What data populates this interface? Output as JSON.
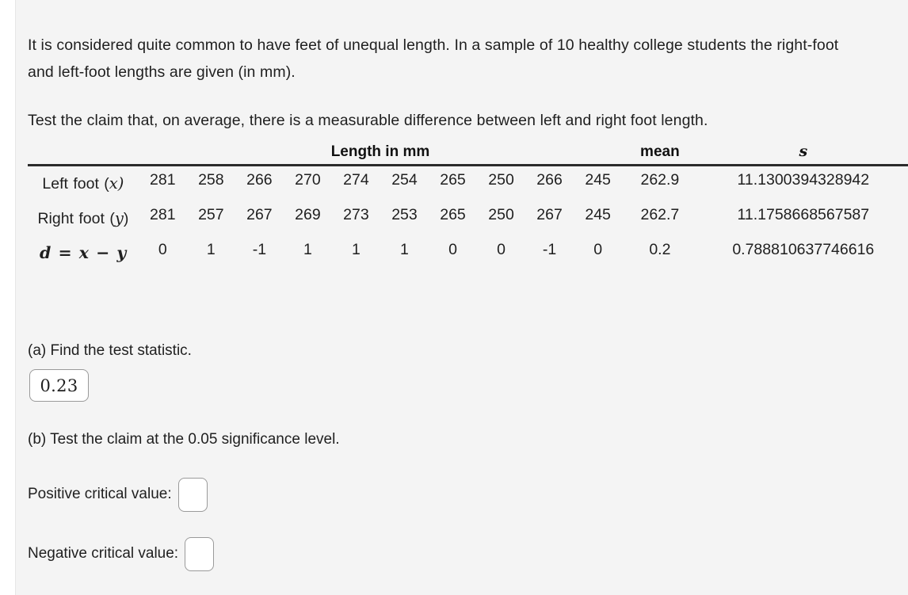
{
  "intro": {
    "paragraph": "It is considered quite common to have feet of unequal length. In a sample of 10 healthy college students the right-foot and left-foot lengths are given (in mm).",
    "claim": "Test the claim that, on average, there is a measurable difference between left and right foot length."
  },
  "table": {
    "headers": {
      "label": "",
      "length": "Length in mm",
      "mean": "mean",
      "s": "s"
    },
    "rows": [
      {
        "label_text": "Left foot (",
        "label_var": "x",
        "label_close": ")",
        "values": [
          "281",
          "258",
          "266",
          "270",
          "274",
          "254",
          "265",
          "250",
          "266",
          "245"
        ],
        "mean": "262.9",
        "s": "11.1300394328942"
      },
      {
        "label_text": "Right foot",
        "label_var": "y",
        "label_open": "(",
        "label_close": ")",
        "values": [
          "281",
          "257",
          "267",
          "269",
          "273",
          "253",
          "265",
          "250",
          "267",
          "245"
        ],
        "mean": "262.7",
        "s": "11.1758668567587"
      },
      {
        "label_math": "d = x − y",
        "values": [
          "0",
          "1",
          "-1",
          "1",
          "1",
          "1",
          "0",
          "0",
          "-1",
          "0"
        ],
        "mean": "0.2",
        "s": "0.788810637746616"
      }
    ]
  },
  "questions": {
    "part_a_text": "(a) Find the test statistic.",
    "test_statistic_value": "0.23",
    "part_b_text": "(b) Test the claim at the 0.05 significance level.",
    "positive_critical_label": "Positive critical value:",
    "positive_critical_value": "",
    "negative_critical_label": "Negative critical value:",
    "negative_critical_value": ""
  },
  "colors": {
    "page_background": "#f4f4f4",
    "text": "#1f1f1f",
    "rule": "#2b2b2b",
    "input_border": "#9a9a9a",
    "input_fill": "#ffffff"
  }
}
